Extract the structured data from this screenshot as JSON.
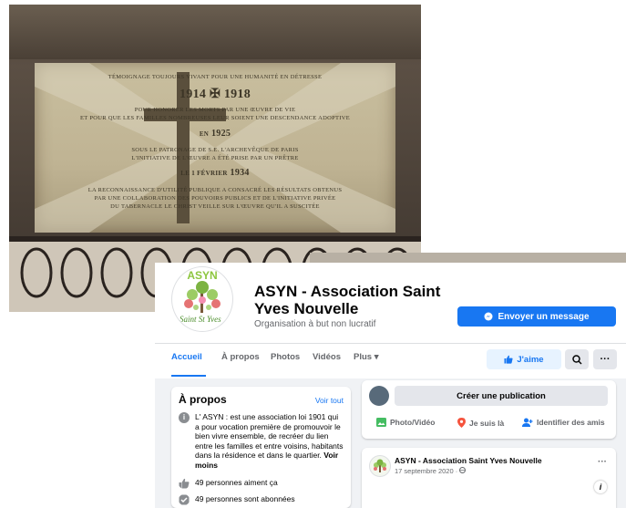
{
  "plaque": {
    "line1": "TÉMOIGNAGE TOUJOURS VIVANT POUR UNE HUMANITÉ EN DÉTRESSE",
    "years1": "1914 ✠ 1918",
    "line2": "POUR HONORER LES MORTS PAR UNE ŒUVRE DE VIE",
    "line3": "ET POUR QUE LES FAMILLES NOMBREUSES LEUR SOIENT UNE DESCENDANCE ADOPTIVE",
    "en": "EN",
    "year2": "1925",
    "line4": "SOUS LE PATRONAGE DE S.E. L'ARCHEVÊQUE DE PARIS",
    "line5": "L'INITIATIVE DE L'ŒUVRE A ÉTÉ PRISE PAR UN PRÊTRE",
    "date3": "LE 1 FÉVRIER",
    "year3": "1934",
    "line6": "LA RECONNAISSANCE D'UTILITÉ PUBLIQUE A CONSACRÉ LES RÉSULTATS OBTENUS",
    "line7": "PAR UNE COLLABORATION DES POUVOIRS PUBLICS ET DE L'INITIATIVE PRIVÉE",
    "line8": "DU TABERNACLE LE CHRIST VEILLE SUR L'ŒUVRE QU'IL A SUSCITÉE"
  },
  "page": {
    "logo_text": "ASYN",
    "logo_signature": "Saint St Yves",
    "name": "ASYN - Association Saint Yves Nouvelle",
    "category": "Organisation à but non lucratif",
    "message_button": "Envoyer un message"
  },
  "tabs": [
    "Accueil",
    "À propos",
    "Photos",
    "Vidéos",
    "Plus ▾"
  ],
  "actions": {
    "like": "J'aime",
    "search_icon": "search-icon",
    "more_icon": "more-icon"
  },
  "about": {
    "title": "À propos",
    "see_all": "Voir tout",
    "description": "L' ASYN : est une association loi 1901 qui a pour vocation première de promouvoir le bien vivre ensemble, de recréer du lien entre les familles et entre voisins, habitants dans la résidence et dans le quartier.",
    "see_less": "Voir moins",
    "likes": "49 personnes aiment ça",
    "followers": "49 personnes sont abonnées"
  },
  "composer": {
    "create": "Créer une publication",
    "photo": "Photo/Vidéo",
    "checkin": "Je suis là",
    "tag": "Identifier des amis"
  },
  "post": {
    "author": "ASYN - Association Saint Yves Nouvelle",
    "date": "17 septembre 2020 · ",
    "more": "···",
    "info": "i"
  },
  "colors": {
    "brand": "#1877f2",
    "logo_green": "#8dc63f"
  }
}
